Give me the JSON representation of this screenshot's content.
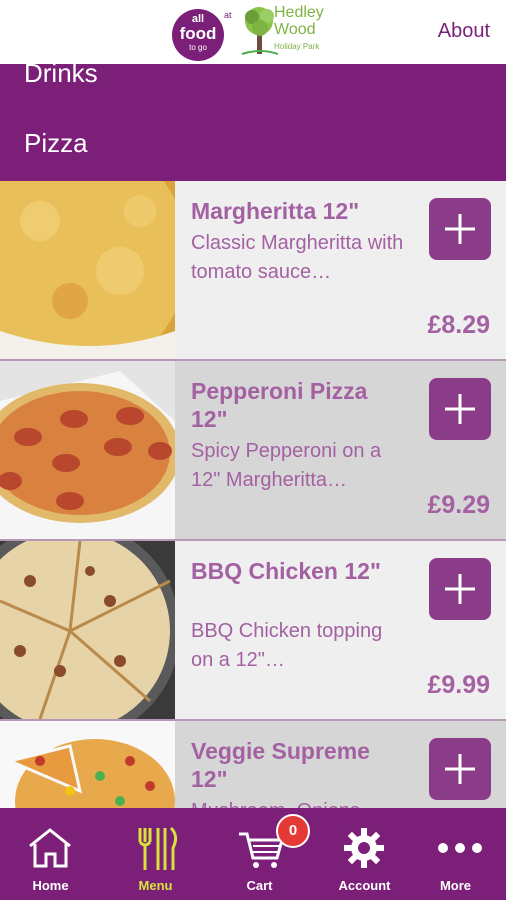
{
  "header": {
    "logo_food": {
      "line1": "all",
      "line2": "food",
      "line3": "to go"
    },
    "logo_at": "at",
    "logo_partner": {
      "line1": "Hedley",
      "line2": "Wood",
      "line3": "Holiday Park"
    },
    "about_label": "About"
  },
  "categories": [
    "Drinks",
    "Pizza"
  ],
  "items": [
    {
      "name": "Margheritta 12\"",
      "desc": "Classic Margheritta with tomato sauce…",
      "price": "£8.29"
    },
    {
      "name": "Pepperoni Pizza 12\"",
      "desc": "Spicy Pepperoni on a 12\" Margheritta…",
      "price": "£9.29"
    },
    {
      "name": "BBQ Chicken 12\"",
      "desc": "BBQ Chicken topping on a 12\"…",
      "price": "£9.99"
    },
    {
      "name": "Veggie Supreme 12\"",
      "desc": "Mushroom, Onions",
      "price": ""
    }
  ],
  "tabbar": {
    "tabs": [
      {
        "label": "Home",
        "icon": "home-icon"
      },
      {
        "label": "Menu",
        "icon": "fork-knife-icon"
      },
      {
        "label": "Cart",
        "icon": "cart-icon"
      },
      {
        "label": "Account",
        "icon": "gear-icon"
      },
      {
        "label": "More",
        "icon": "more-dots-icon"
      }
    ],
    "active": "Menu",
    "cart_count": "0"
  },
  "colors": {
    "brand": "#7b1f78",
    "text_accent": "#a461a2",
    "active_tab": "#d7e23a",
    "badge": "#e53935",
    "button": "#8b3c89"
  }
}
